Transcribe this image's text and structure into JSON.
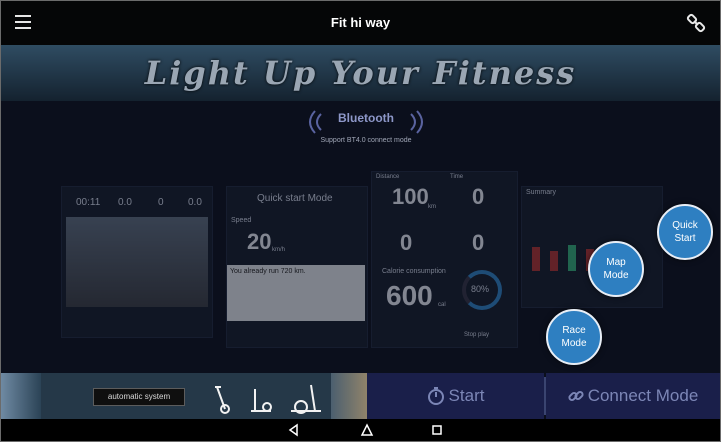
{
  "app": {
    "title": "Fit hi way",
    "tagline": "Light Up Your Fitness"
  },
  "bluetooth": {
    "label": "Bluetooth",
    "subtitle": "Support BT4.0 connect mode"
  },
  "preview": {
    "timer": "00:11",
    "v1": "0.0",
    "v2": "0",
    "v3": "0.0",
    "mode_title": "Quick start Mode",
    "speed_label": "Speed",
    "speed_value": "20",
    "speed_unit": "km/h",
    "message": "You already run 720 km.",
    "distance_label": "Distance",
    "distance_value": "100",
    "distance_unit": "km",
    "time_label": "Time",
    "time_value": "0",
    "heart_value": "0",
    "rpm_value": "0",
    "calorie_label": "Calorie consumption",
    "calorie_value": "600",
    "calorie_unit": "cal",
    "percent": "80%",
    "summary_title": "Summary",
    "stop_label": "Stop play"
  },
  "modes": {
    "quick_start": "Quick\nStart",
    "map_mode": "Map\nMode",
    "race_mode": "Race\nMode"
  },
  "bottom": {
    "auto_system": "automatic system",
    "start": "Start",
    "connect": "Connect Mode"
  },
  "colors": {
    "accent": "#2e7fc1",
    "bar": "#1a1f4a"
  }
}
